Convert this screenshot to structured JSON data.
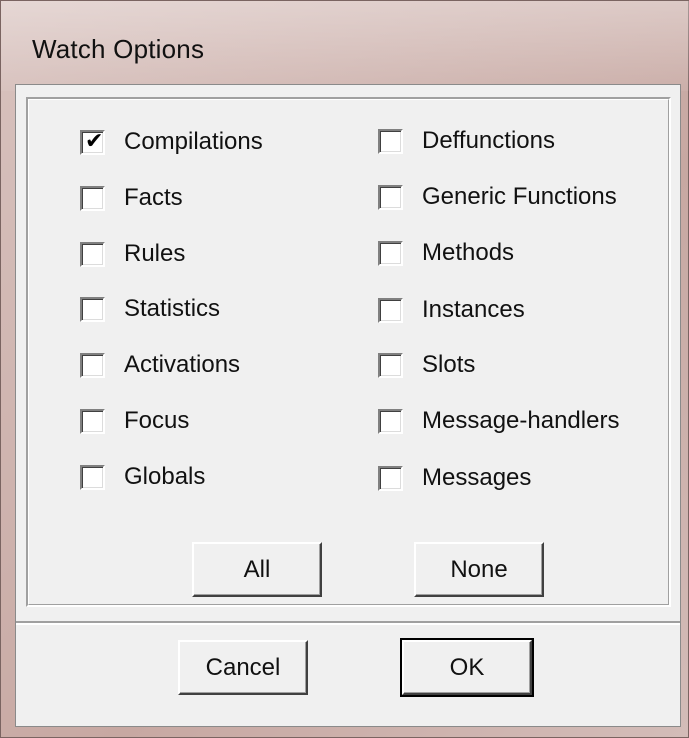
{
  "window": {
    "title": "Watch Options"
  },
  "options_left": [
    {
      "label": "Compilations",
      "checked": true
    },
    {
      "label": "Facts",
      "checked": false
    },
    {
      "label": "Rules",
      "checked": false
    },
    {
      "label": "Statistics",
      "checked": false
    },
    {
      "label": "Activations",
      "checked": false
    },
    {
      "label": "Focus",
      "checked": false
    },
    {
      "label": "Globals",
      "checked": false
    }
  ],
  "options_right": [
    {
      "label": "Deffunctions",
      "checked": false
    },
    {
      "label": "Generic Functions",
      "checked": false
    },
    {
      "label": "Methods",
      "checked": false
    },
    {
      "label": "Instances",
      "checked": false
    },
    {
      "label": "Slots",
      "checked": false
    },
    {
      "label": "Message-handlers",
      "checked": false
    },
    {
      "label": "Messages",
      "checked": false
    }
  ],
  "buttons": {
    "all": "All",
    "none": "None",
    "cancel": "Cancel",
    "ok": "OK"
  },
  "check_glyph": "✔"
}
